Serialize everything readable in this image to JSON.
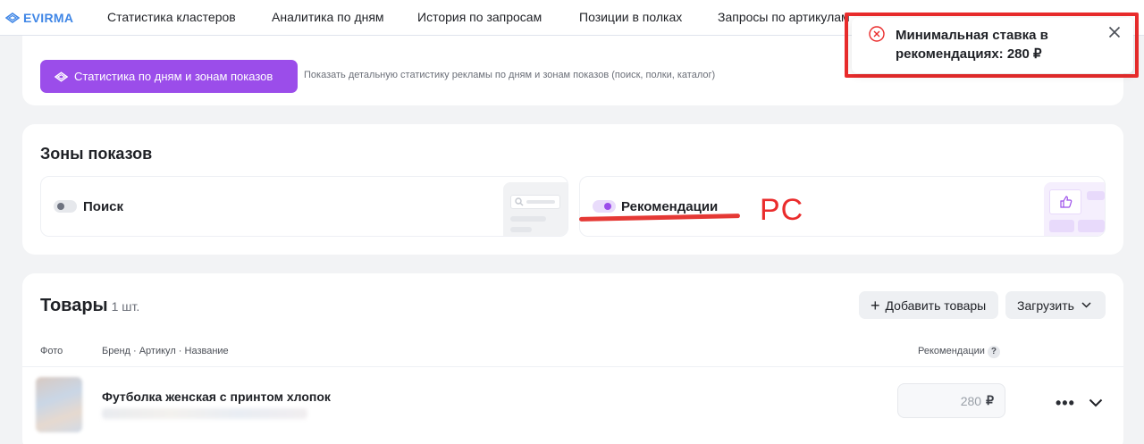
{
  "brand": {
    "name": "EVIRMA",
    "color": "#3f86e6"
  },
  "nav": {
    "items": [
      "Статистика кластеров",
      "Аналитика по дням",
      "История по запросам",
      "Позиции в полках",
      "Запросы по артикулам"
    ]
  },
  "stats_card": {
    "button_label": "Статистика по дням и зонам показов",
    "hint": "Показать детальную статистику рекламы по дням и зонам показов (поиск, полки, каталог)"
  },
  "zones": {
    "title": "Зоны показов",
    "items": [
      {
        "label": "Поиск",
        "enabled": false,
        "icon": "search-illustration-icon"
      },
      {
        "label": "Рекомендации",
        "enabled": true,
        "icon": "thumbs-up-illustration-icon"
      }
    ],
    "annotation": "PC"
  },
  "goods": {
    "title": "Товары",
    "count": "1 шт.",
    "add_button": "Добавить товары",
    "load_button": "Загрузить",
    "columns": {
      "photo": "Фото",
      "brand": "Бренд · Артикул · Название",
      "recommendations": "Рекомендации",
      "help": "?"
    },
    "rows": [
      {
        "name": "Футболка женская с принтом хлопок",
        "price_placeholder": "280",
        "currency": "₽"
      }
    ]
  },
  "toast": {
    "message": "Минимальная ставка в рекомендациях: 280 ₽",
    "type": "error",
    "accent": "#ea2c2c"
  },
  "accent_purple": "#9b4dea"
}
